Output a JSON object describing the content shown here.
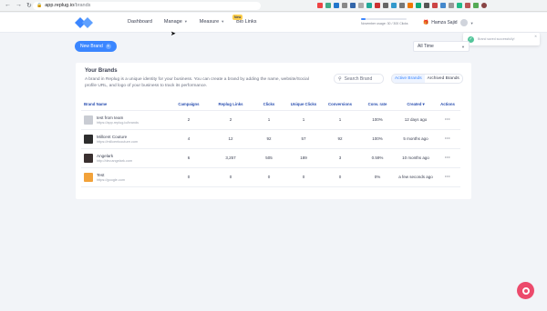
{
  "browser": {
    "url_host": "app.replug.io",
    "url_path": "/brands"
  },
  "header": {
    "nav": [
      {
        "label": "Dashboard"
      },
      {
        "label": "Manage"
      },
      {
        "label": "Measure"
      },
      {
        "label": "Bio Links"
      }
    ],
    "new_badge": "New",
    "usage_text": "November usage: 30 / 300 Clicks",
    "usage_fraction": 0.1,
    "user_name": "Hamza Sajid"
  },
  "toast": {
    "message": "Brand saved successfully!"
  },
  "controls": {
    "new_brand_label": "New Brand",
    "filter_value": "All Time"
  },
  "card": {
    "title": "Your Brands",
    "description": "A brand in Replug is a unique identity for your business. You can create a brand by adding the name, website/Social profile URL, and logo of your business to track its performance.",
    "search_placeholder": "Search Brand",
    "tab_active": "Active Brands",
    "tab_archived": "Archived Brands"
  },
  "table": {
    "headers": [
      "Brand Name",
      "Campaigns",
      "Replug Links",
      "Clicks",
      "Unique Clicks",
      "Conversions",
      "Conv. rate",
      "Created ▾",
      "Actions"
    ],
    "rows": [
      {
        "name": "test from team",
        "url": "https://app.replug.io/brands",
        "campaigns": "2",
        "links": "2",
        "clicks": "1",
        "unique": "1",
        "conversions": "1",
        "rate": "100%",
        "created": "12 days ago",
        "thumb_color": "#c9ccd3"
      },
      {
        "name": "Millcent Couture",
        "url": "https://millcentcouture.com",
        "campaigns": "4",
        "links": "12",
        "clicks": "92",
        "unique": "57",
        "conversions": "92",
        "rate": "100%",
        "created": "5 months ago",
        "thumb_color": "#2d2d2d"
      },
      {
        "name": "Angelark",
        "url": "http://dev.angelark.com",
        "campaigns": "6",
        "links": "3,257",
        "clicks": "505",
        "unique": "189",
        "conversions": "3",
        "rate": "0.59%",
        "created": "10 months ago",
        "thumb_color": "#3a3030"
      },
      {
        "name": "Test",
        "url": "https://google.com",
        "campaigns": "0",
        "links": "0",
        "clicks": "0",
        "unique": "0",
        "conversions": "0",
        "rate": "0%",
        "created": "a few seconds ago",
        "thumb_color": "#f2a23a"
      }
    ]
  },
  "colors": {
    "accent": "#3b86ff",
    "help": "#ec4a6c"
  }
}
